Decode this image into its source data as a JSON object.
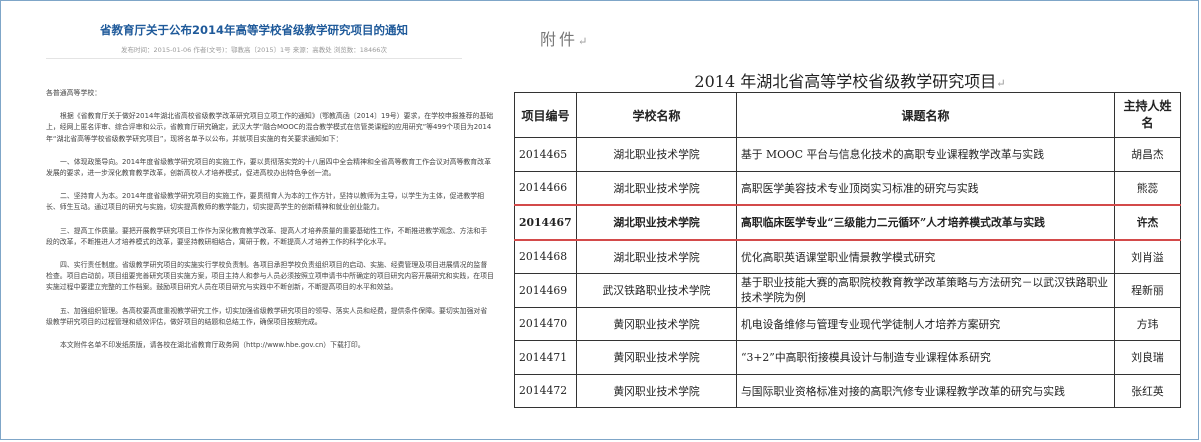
{
  "notice": {
    "title": "省教育厅关于公布2014年高等学校省级教学研究项目的通知",
    "meta": "发布时间：2015-01-06 作者(文号)：鄂教高〔2015〕1号 来源：高教处 浏览数：18466次",
    "greeting": "各普通高等学校：",
    "paragraphs": [
      "根据《省教育厅关于做好2014年湖北省高校省级教学改革研究项目立项工作的通知》（鄂教高函〔2014〕19号）要求，在学校申报推荐的基础上，经网上匿名评审、综合评审和公示，省教育厅研究确定，武汉大学“融合MOOC的混合教学模式在信管类课程的应用研究”等499个项目为2014年“湖北省高等学校省级教学研究项目”，现将名单予以公布，并就项目实施的有关要求通知如下：",
      "一、体现政策导向。2014年度省级教学研究项目的实施工作，要以贯彻落实党的十八届四中全会精神和全省高等教育工作会议对高等教育改革发展的要求，进一步深化教育教学改革，创新高校人才培养模式，促进高校办出特色争创一流。",
      "二、坚持育人为本。2014年度省级教学研究项目的实施工作，要贯彻育人为本的工作方针，坚持以教师为主导，以学生为主体，促进教学相长、师生互动。通过项目的研究与实施，切实提高教师的教学能力，切实提高学生的创新精神和就业创业能力。",
      "三、提高工作质量。要把开展教学研究项目工作作为深化教育教学改革、提高人才培养质量的重要基础性工作，不断推进教学观念、方法和手段的改革，不断推进人才培养模式的改革，要坚持教研相结合，寓研于教，不断提高人才培养工作的科学化水平。",
      "四、实行责任制度。省级教学研究项目的实施实行学校负责制。各项目承担学校负责组织项目的启动、实施、经费管理及项目进展情况的监督检查。项目启动前，项目组要完善研究项目实施方案，项目主持人和参与人员必须按照立项申请书中所确定的项目研究内容开展研究和实践，在项目实施过程中要建立完整的工作档案。鼓励项目研究人员在项目研究与实践中不断创新，不断提高项目的水平和效益。",
      "五、加强组织管理。各高校要高度重视教学研究工作，切实加强省级教学研究项目的领导、落实人员和经费，提供条件保障。要切实加强对省级教学研究项目的过程管理和绩效评估，做好项目的结题和总结工作，确保项目按期完成。",
      "本文附件名单不印发纸质版，请各校在湖北省教育厅政务网（http://www.hbe.gov.cn）下载打印。"
    ]
  },
  "attachment": {
    "label": "附件",
    "title": "2014 年湖北省高等学校省级教学研究项目",
    "para_mark": "↵",
    "headers": [
      "项目编号",
      "学校名称",
      "课题名称",
      "主持人姓名"
    ],
    "rows": [
      {
        "id": "2014465",
        "school": "湖北职业技术学院",
        "topic": "基于 MOOC 平台与信息化技术的高职专业课程教学改革与实践",
        "person": "胡昌杰",
        "highlight": false
      },
      {
        "id": "2014466",
        "school": "湖北职业技术学院",
        "topic": "高职医学美容技术专业顶岗实习标准的研究与实践",
        "person": "熊蕊",
        "highlight": false
      },
      {
        "id": "2014467",
        "school": "湖北职业技术学院",
        "topic": "高职临床医学专业“三级能力二元循环”人才培养模式改革与实践",
        "person": "许杰",
        "highlight": true
      },
      {
        "id": "2014468",
        "school": "湖北职业技术学院",
        "topic": "优化高职英语课堂职业情景教学模式研究",
        "person": "刘肖溢",
        "highlight": false
      },
      {
        "id": "2014469",
        "school": "武汉铁路职业技术学院",
        "topic": "基于职业技能大赛的高职院校教育教学改革策略与方法研究－以武汉铁路职业技术学院为例",
        "person": "程新丽",
        "highlight": false
      },
      {
        "id": "2014470",
        "school": "黄冈职业技术学院",
        "topic": "机电设备维修与管理专业现代学徒制人才培养方案研究",
        "person": "方玮",
        "highlight": false
      },
      {
        "id": "2014471",
        "school": "黄冈职业技术学院",
        "topic": "“3+2”中高职衔接模具设计与制造专业课程体系研究",
        "person": "刘良瑞",
        "highlight": false
      },
      {
        "id": "2014472",
        "school": "黄冈职业技术学院",
        "topic": "与国际职业资格标准对接的高职汽修专业课程教学改革的研究与实践",
        "person": "张红英",
        "highlight": false
      }
    ]
  }
}
